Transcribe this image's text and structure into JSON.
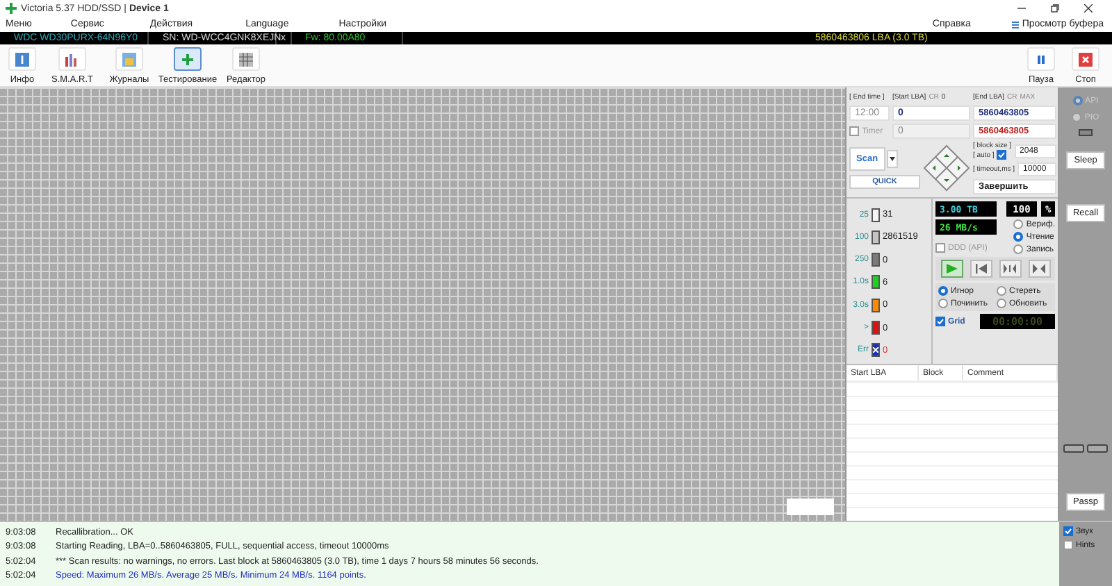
{
  "window": {
    "title": "Victoria 5.37 HDD/SSD | **Device 1**"
  },
  "menu": {
    "items": [
      "Меню",
      "Сервис",
      "Действия",
      "Language",
      "Настройки"
    ],
    "help": "Справка",
    "buffer": "Просмотр буфера"
  },
  "drive_bar": {
    "model": "WDC WD30PURX-64N96Y0",
    "serial": "SN: WD-WCC4GNK8XEJN",
    "close": "x",
    "firmware": "Fw: 80.00A80",
    "capacity": "5860463806 LBA (3.0 TB)"
  },
  "toolbar": {
    "tools": [
      {
        "label": "Инфо",
        "kind": "info",
        "selected": false
      },
      {
        "label": "S.M.A.R.T",
        "kind": "smart",
        "selected": false
      },
      {
        "label": "Журналы",
        "kind": "logs",
        "selected": false
      },
      {
        "label": "Тестирование",
        "kind": "test",
        "selected": true
      },
      {
        "label": "Редактор",
        "kind": "editor",
        "selected": false
      }
    ],
    "actions": [
      {
        "label": "Пауза",
        "kind": "pause"
      },
      {
        "label": "Стоп",
        "kind": "stop"
      }
    ]
  },
  "scan": {
    "end_time_label": "[ End time ]",
    "end_time": "12:00",
    "start_lba_label": "[Start LBA]",
    "start_cr": "CR",
    "start_zero": "0",
    "end_lba_label": "[End LBA]",
    "end_cr": "CR",
    "end_max": "MAX",
    "start_lba": "0",
    "end_lba": "5860463805",
    "end_lba_current": "5860463805",
    "timer": {
      "label": "Timer",
      "checked": false,
      "disabled": true,
      "value": "0"
    },
    "scan_button": "Scan",
    "quick_button": "QUICK",
    "block_size_label": "[ block size ]",
    "auto_label": "[ auto ]",
    "auto_checked": true,
    "block_size": "2048",
    "timeout_label": "[ timeout,ms ]",
    "timeout": "10000",
    "finish_action": "Завершить"
  },
  "side": {
    "modes": [
      {
        "label": "API",
        "selected": true,
        "disabled": true
      },
      {
        "label": "PIO",
        "selected": false,
        "disabled": true
      }
    ],
    "sleep": "Sleep",
    "recall": "Recall",
    "passp": "Passp"
  },
  "counts": [
    {
      "label": "25",
      "value": "31",
      "color": "#f4f4f4"
    },
    {
      "label": "100",
      "value": "2861519",
      "color": "#c4c4c4"
    },
    {
      "label": "250",
      "value": "0",
      "color": "#7a7a7a"
    },
    {
      "label": "1.0s",
      "value": "6",
      "color": "#1fd11f"
    },
    {
      "label": "3.0s",
      "value": "0",
      "color": "#ff8a00"
    },
    {
      "label": ">",
      "value": "0",
      "color": "#e01010"
    },
    {
      "label": "Err",
      "value": "0",
      "color": "#1530c8",
      "kind": "error"
    }
  ],
  "status": {
    "size": "3.00 TB",
    "percent": "100",
    "percent_sign": "%",
    "speed": "26 MB/s",
    "ddd": {
      "label": "DDD (API)",
      "checked": false,
      "disabled": true
    },
    "modes": [
      {
        "label": "Вериф.",
        "selected": false
      },
      {
        "label": "Чтение",
        "selected": true
      },
      {
        "label": "Запись",
        "selected": false
      }
    ],
    "transport": [
      {
        "kind": "play",
        "selected": true
      },
      {
        "kind": "back",
        "selected": false
      },
      {
        "kind": "random",
        "selected": false
      },
      {
        "kind": "end",
        "selected": false
      }
    ],
    "error_actions": [
      {
        "label": "Игнор",
        "selected": true
      },
      {
        "label": "Стереть",
        "selected": false
      },
      {
        "label": "Починить",
        "selected": false
      },
      {
        "label": "Обновить",
        "selected": false
      }
    ],
    "grid": {
      "label": "Grid",
      "checked": true
    },
    "elapsed": "00:00:00"
  },
  "table": {
    "columns": [
      "Start LBA",
      "Block",
      "Comment"
    ]
  },
  "log": [
    {
      "time": "9:03:08",
      "text": "Recallibration... OK",
      "kind": "normal"
    },
    {
      "time": "9:03:08",
      "text": "Starting Reading, LBA=0..5860463805, FULL, sequential access, timeout 10000ms",
      "kind": "normal"
    },
    {
      "time": "5:02:04",
      "text": "*** Scan results: no warnings, no errors. Last block at 5860463805 (3.0 TB), time 1 days 7 hours 58 minutes 56 seconds.",
      "kind": "normal"
    },
    {
      "time": "5:02:04",
      "text": "Speed: Maximum 26 MB/s. Average 25 MB/s. Minimum 24 MB/s. 1164 points.",
      "kind": "highlight"
    }
  ],
  "log_options": [
    {
      "label": "Звук",
      "checked": true
    },
    {
      "label": "Hints",
      "checked": false
    }
  ]
}
